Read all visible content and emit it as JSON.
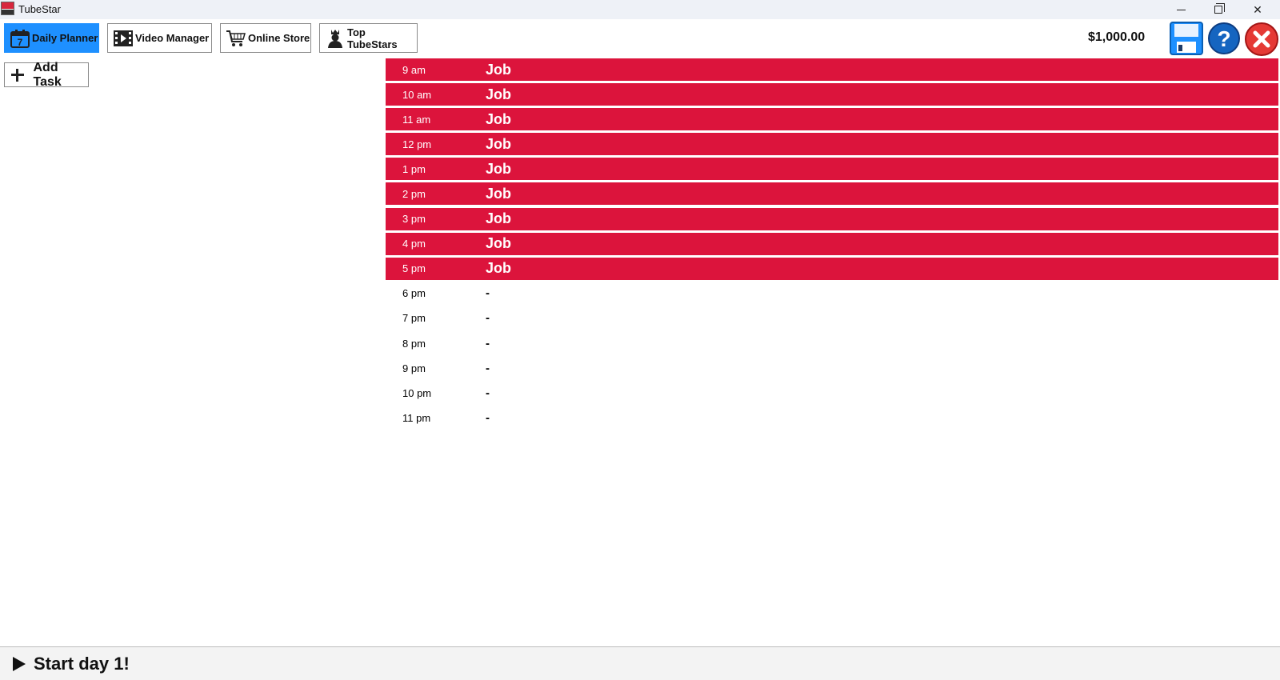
{
  "window": {
    "title": "TubeStar"
  },
  "toolbar": {
    "tabs": [
      {
        "label": "Daily Planner",
        "icon": "calendar-icon",
        "active": true
      },
      {
        "label": "Video Manager",
        "icon": "film-icon",
        "active": false
      },
      {
        "label": "Online Store",
        "icon": "cart-icon",
        "active": false
      },
      {
        "label": "Top TubeStars",
        "icon": "crown-person-icon",
        "active": false
      }
    ],
    "calendar_day": "7",
    "money": "$1,000.00"
  },
  "add_task": {
    "label": "Add Task"
  },
  "schedule": [
    {
      "time": "9 am",
      "task": "Job",
      "type": "job"
    },
    {
      "time": "10 am",
      "task": "Job",
      "type": "job"
    },
    {
      "time": "11 am",
      "task": "Job",
      "type": "job"
    },
    {
      "time": "12 pm",
      "task": "Job",
      "type": "job"
    },
    {
      "time": "1 pm",
      "task": "Job",
      "type": "job"
    },
    {
      "time": "2 pm",
      "task": "Job",
      "type": "job"
    },
    {
      "time": "3 pm",
      "task": "Job",
      "type": "job"
    },
    {
      "time": "4 pm",
      "task": "Job",
      "type": "job"
    },
    {
      "time": "5 pm",
      "task": "Job",
      "type": "job"
    },
    {
      "time": "6 pm",
      "task": "-",
      "type": "empty"
    },
    {
      "time": "7 pm",
      "task": "-",
      "type": "empty"
    },
    {
      "time": "8 pm",
      "task": "-",
      "type": "empty"
    },
    {
      "time": "9 pm",
      "task": "-",
      "type": "empty"
    },
    {
      "time": "10 pm",
      "task": "-",
      "type": "empty"
    },
    {
      "time": "11 pm",
      "task": "-",
      "type": "empty"
    }
  ],
  "start": {
    "label": "Start day 1!"
  },
  "colors": {
    "accent": "#1e90ff",
    "job": "#dc143c",
    "help": "#1565c0",
    "close": "#e53935"
  }
}
